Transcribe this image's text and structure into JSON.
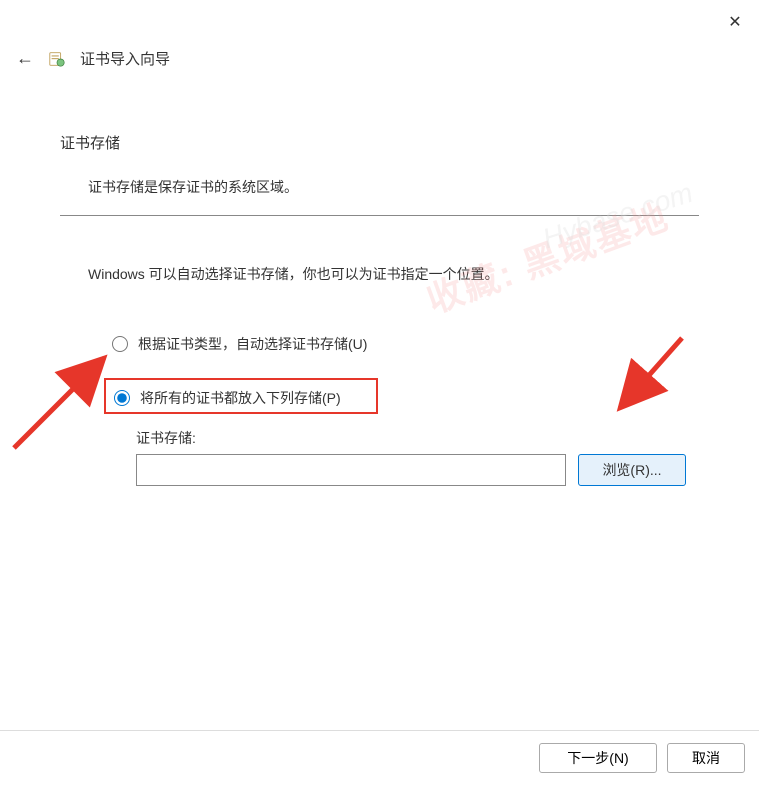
{
  "window": {
    "title": "证书导入向导"
  },
  "section": {
    "heading": "证书存储",
    "description": "证书存储是保存证书的系统区域。",
    "instruction": "Windows 可以自动选择证书存储，你也可以为证书指定一个位置。"
  },
  "radio": {
    "auto": "根据证书类型，自动选择证书存储(U)",
    "manual": "将所有的证书都放入下列存储(P)",
    "selected": "manual"
  },
  "store": {
    "label": "证书存储:",
    "value": ""
  },
  "buttons": {
    "browse": "浏览(R)...",
    "next": "下一步(N)",
    "cancel": "取消"
  },
  "watermark": {
    "text1": "收藏: 黑域基地",
    "text2": "Hybase.com"
  }
}
